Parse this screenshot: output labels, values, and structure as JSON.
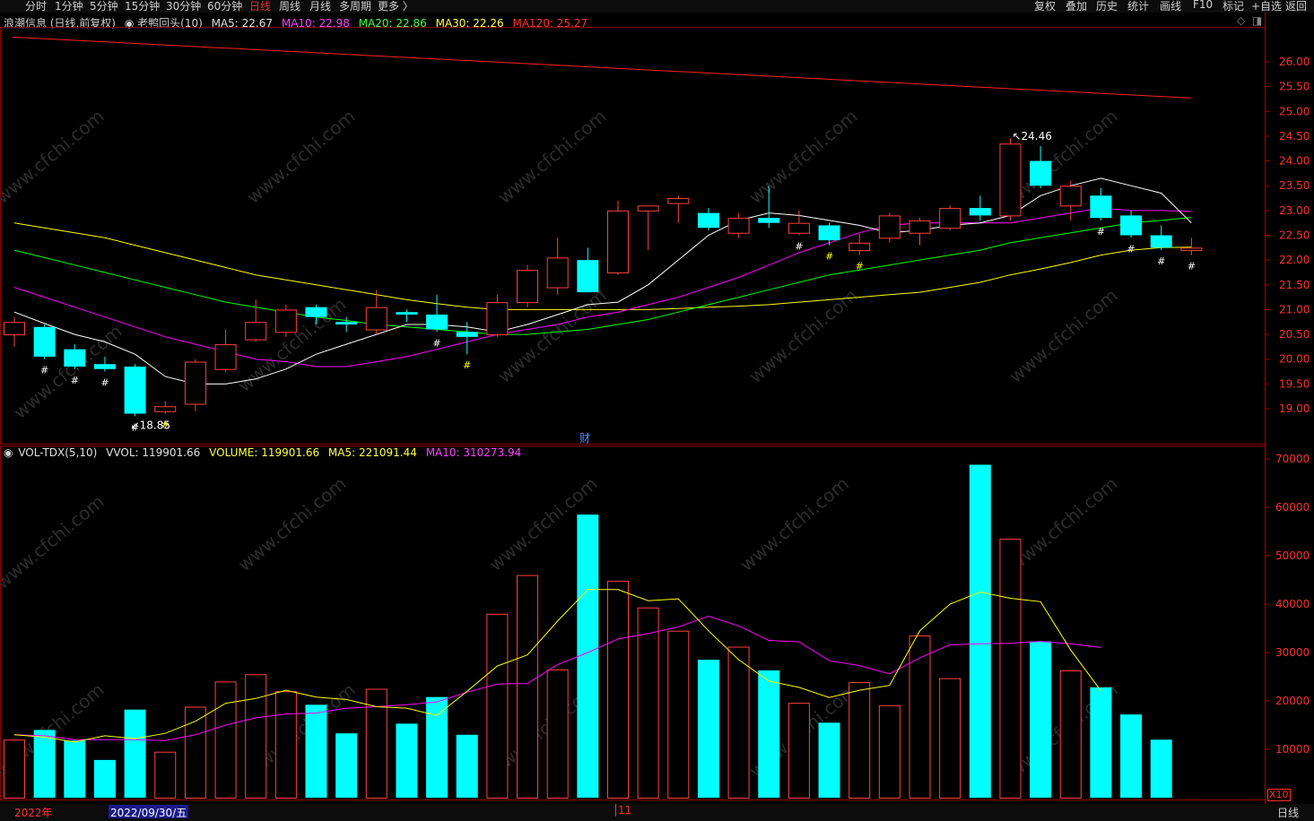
{
  "periods": [
    "分时",
    "1分钟",
    "5分钟",
    "15分钟",
    "30分钟",
    "60分钟",
    "日线",
    "周线",
    "月线",
    "多周期",
    "更多 〉"
  ],
  "active_period": "日线",
  "tools": [
    "复权",
    "叠加",
    "历史",
    "统计",
    "画线",
    "F10",
    "标记",
    "+自选",
    "返回"
  ],
  "price_info": {
    "stock": "浪潮信息 (日线,前复权)",
    "indicator": "老鸭回头(10)",
    "ma5": "MA5: 22.67",
    "ma10": "MA10: 22.98",
    "ma20": "MA20: 22.86",
    "ma30": "MA30: 22.26",
    "ma120": "MA120: 25.27"
  },
  "vol_info": {
    "name": "VOL-TDX(5,10)",
    "vvol": "VVOL: 119901.66",
    "volume": "VOLUME: 119901.66",
    "ma5": "MA5: 221091.44",
    "ma10": "MA10: 310273.94"
  },
  "bottom": {
    "year": "2022年",
    "date": "2022/09/30/五",
    "month_mark": "11",
    "period": "日线",
    "vol_unit": "X10"
  },
  "annotations": {
    "high": "24.46",
    "low": "18.85",
    "cai": "财"
  },
  "watermark": "www.cfchi.com",
  "colors": {
    "up": "#ff4040",
    "down": "#00ffff",
    "ma5": "#ffffff",
    "ma10": "#ff00ff",
    "ma20": "#00ff00",
    "ma30": "#ffff00",
    "ma120": "#ff2020",
    "vol_ma5": "#ffff00",
    "vol_ma10": "#ff00ff"
  },
  "chart_data": {
    "type": "candlestick",
    "price_axis": {
      "ticks": [
        19.0,
        19.5,
        20.0,
        20.5,
        21.0,
        21.5,
        22.0,
        22.5,
        23.0,
        23.5,
        24.0,
        24.5,
        25.0,
        25.5,
        26.0
      ]
    },
    "candles": [
      {
        "o": 20.5,
        "h": 20.85,
        "l": 20.25,
        "c": 20.75
      },
      {
        "o": 20.65,
        "h": 20.7,
        "l": 20.0,
        "c": 20.05
      },
      {
        "o": 20.2,
        "h": 20.3,
        "l": 19.8,
        "c": 19.85
      },
      {
        "o": 19.9,
        "h": 20.05,
        "l": 19.75,
        "c": 19.8
      },
      {
        "o": 19.85,
        "h": 19.9,
        "l": 18.85,
        "c": 18.9
      },
      {
        "o": 18.95,
        "h": 19.15,
        "l": 18.9,
        "c": 19.05
      },
      {
        "o": 19.1,
        "h": 20.0,
        "l": 18.95,
        "c": 19.95
      },
      {
        "o": 19.8,
        "h": 20.6,
        "l": 19.75,
        "c": 20.3
      },
      {
        "o": 20.4,
        "h": 21.2,
        "l": 20.35,
        "c": 20.75
      },
      {
        "o": 20.55,
        "h": 21.1,
        "l": 20.45,
        "c": 21.0
      },
      {
        "o": 21.05,
        "h": 21.1,
        "l": 20.7,
        "c": 20.85
      },
      {
        "o": 20.75,
        "h": 20.85,
        "l": 20.55,
        "c": 20.7
      },
      {
        "o": 20.6,
        "h": 21.4,
        "l": 20.5,
        "c": 21.05
      },
      {
        "o": 20.95,
        "h": 21.0,
        "l": 20.75,
        "c": 20.9
      },
      {
        "o": 20.9,
        "h": 21.3,
        "l": 20.55,
        "c": 20.6
      },
      {
        "o": 20.55,
        "h": 20.75,
        "l": 20.1,
        "c": 20.45
      },
      {
        "o": 20.5,
        "h": 21.3,
        "l": 20.45,
        "c": 21.15
      },
      {
        "o": 21.15,
        "h": 21.9,
        "l": 21.05,
        "c": 21.8
      },
      {
        "o": 21.45,
        "h": 22.45,
        "l": 21.3,
        "c": 22.05
      },
      {
        "o": 22.0,
        "h": 22.25,
        "l": 21.35,
        "c": 21.35
      },
      {
        "o": 21.75,
        "h": 23.2,
        "l": 21.7,
        "c": 23.0
      },
      {
        "o": 23.0,
        "h": 23.1,
        "l": 22.2,
        "c": 23.1
      },
      {
        "o": 23.15,
        "h": 23.3,
        "l": 22.75,
        "c": 23.25
      },
      {
        "o": 22.95,
        "h": 23.05,
        "l": 22.6,
        "c": 22.65
      },
      {
        "o": 22.55,
        "h": 22.95,
        "l": 22.45,
        "c": 22.85
      },
      {
        "o": 22.85,
        "h": 23.5,
        "l": 22.65,
        "c": 22.75
      },
      {
        "o": 22.55,
        "h": 23.0,
        "l": 22.5,
        "c": 22.75
      },
      {
        "o": 22.7,
        "h": 22.75,
        "l": 22.3,
        "c": 22.4
      },
      {
        "o": 22.2,
        "h": 22.55,
        "l": 22.1,
        "c": 22.35
      },
      {
        "o": 22.45,
        "h": 22.95,
        "l": 22.35,
        "c": 22.9
      },
      {
        "o": 22.55,
        "h": 22.85,
        "l": 22.3,
        "c": 22.8
      },
      {
        "o": 22.65,
        "h": 23.1,
        "l": 22.6,
        "c": 23.05
      },
      {
        "o": 23.05,
        "h": 23.3,
        "l": 22.8,
        "c": 22.9
      },
      {
        "o": 22.9,
        "h": 24.46,
        "l": 22.8,
        "c": 24.35
      },
      {
        "o": 24.0,
        "h": 24.3,
        "l": 23.45,
        "c": 23.5
      },
      {
        "o": 23.1,
        "h": 23.6,
        "l": 22.8,
        "c": 23.5
      },
      {
        "o": 23.3,
        "h": 23.45,
        "l": 22.8,
        "c": 22.85
      },
      {
        "o": 22.9,
        "h": 23.0,
        "l": 22.45,
        "c": 22.5
      },
      {
        "o": 22.5,
        "h": 22.7,
        "l": 22.2,
        "c": 22.25
      },
      {
        "o": 22.2,
        "h": 22.45,
        "l": 22.1,
        "c": 22.25
      }
    ],
    "ma5": [
      20.95,
      20.72,
      20.5,
      20.35,
      20.1,
      19.65,
      19.5,
      19.5,
      19.6,
      19.8,
      20.1,
      20.3,
      20.5,
      20.7,
      20.7,
      20.65,
      20.55,
      20.7,
      20.9,
      21.1,
      21.15,
      21.5,
      22.0,
      22.5,
      22.8,
      22.95,
      22.9,
      22.8,
      22.7,
      22.55,
      22.6,
      22.7,
      22.75,
      22.9,
      23.3,
      23.5,
      23.65,
      23.5,
      23.35,
      22.75
    ],
    "ma10": [
      21.45,
      21.25,
      21.05,
      20.85,
      20.65,
      20.45,
      20.3,
      20.15,
      20.0,
      19.95,
      19.85,
      19.85,
      19.95,
      20.05,
      20.2,
      20.35,
      20.5,
      20.6,
      20.7,
      20.85,
      20.95,
      21.1,
      21.25,
      21.45,
      21.65,
      21.9,
      22.15,
      22.35,
      22.55,
      22.7,
      22.75,
      22.75,
      22.75,
      22.75,
      22.85,
      22.95,
      23.05,
      23.0,
      23.0,
      22.98
    ],
    "ma20": [
      22.2,
      22.05,
      21.9,
      21.75,
      21.6,
      21.45,
      21.3,
      21.15,
      21.05,
      20.95,
      20.85,
      20.78,
      20.7,
      20.65,
      20.6,
      20.55,
      20.5,
      20.5,
      20.55,
      20.6,
      20.7,
      20.8,
      20.95,
      21.1,
      21.25,
      21.4,
      21.55,
      21.7,
      21.8,
      21.9,
      22.0,
      22.1,
      22.2,
      22.35,
      22.45,
      22.55,
      22.65,
      22.75,
      22.8,
      22.86
    ],
    "ma30": [
      22.75,
      22.65,
      22.55,
      22.45,
      22.3,
      22.15,
      22.0,
      21.85,
      21.7,
      21.6,
      21.5,
      21.4,
      21.3,
      21.2,
      21.12,
      21.05,
      21.0,
      21.0,
      21.0,
      21.0,
      21.0,
      21.0,
      21.02,
      21.05,
      21.07,
      21.1,
      21.15,
      21.2,
      21.25,
      21.3,
      21.35,
      21.45,
      21.55,
      21.7,
      21.82,
      21.95,
      22.1,
      22.2,
      22.25,
      22.26
    ],
    "ma120": {
      "start": 26.5,
      "end": 25.27
    },
    "hash_marks": [
      1,
      2,
      3,
      4,
      5,
      14,
      15,
      26,
      27,
      28,
      36,
      37,
      38,
      39
    ],
    "hash_yellow": [
      5,
      15,
      27,
      28
    ],
    "volume_axis": {
      "ticks": [
        10000,
        20000,
        30000,
        40000,
        50000,
        60000,
        70000
      ]
    },
    "volume": [
      12000,
      14000,
      11800,
      7800,
      18200,
      9500,
      18800,
      24000,
      25500,
      22000,
      19200,
      13300,
      22500,
      15300,
      20800,
      13000,
      38000,
      46000,
      26500,
      58500,
      44800,
      39300,
      34500,
      28500,
      31200,
      26300,
      19600,
      15500,
      23900,
      19100,
      33500,
      24700,
      68800,
      53500,
      32300,
      26300,
      22800,
      17200,
      11990
    ],
    "volume_ma5": [
      13000,
      12500,
      11500,
      12800,
      12200,
      13300,
      15800,
      19500,
      20500,
      22200,
      20800,
      20300,
      18800,
      18500,
      17000,
      22000,
      27200,
      29500,
      36500,
      43000,
      43000,
      40700,
      41100,
      34500,
      28500,
      24100,
      22800,
      20700,
      22200,
      23200,
      34500,
      40000,
      42500,
      41200,
      40500,
      30500,
      22100
    ],
    "volume_ma10": [
      13000,
      12800,
      12000,
      12000,
      12000,
      11800,
      13000,
      15000,
      16500,
      17300,
      17500,
      18500,
      18800,
      19200,
      19800,
      21800,
      23500,
      23600,
      27500,
      30000,
      32800,
      33900,
      35300,
      37500,
      35500,
      32500,
      32200,
      28300,
      27300,
      25600,
      28900,
      31600,
      31800,
      31900,
      32300,
      31800,
      31027
    ]
  }
}
